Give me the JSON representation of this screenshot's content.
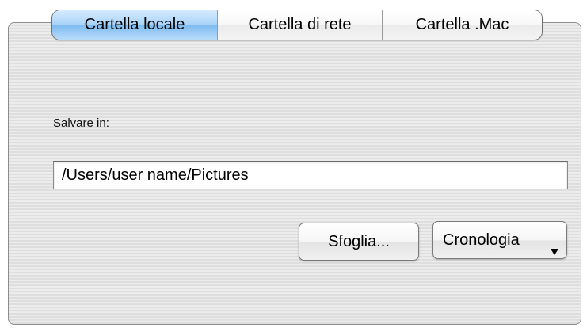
{
  "tabs": [
    {
      "label": "Cartella locale",
      "selected": true
    },
    {
      "label": "Cartella di rete",
      "selected": false
    },
    {
      "label": "Cartella .Mac",
      "selected": false
    }
  ],
  "save_location": {
    "label": "Salvare in:",
    "path_value": "/Users/user name/Pictures"
  },
  "buttons": {
    "browse_label": "Sfoglia...",
    "history_label": "Cronologia",
    "history_icon": "triangle-down-icon"
  },
  "colors": {
    "selected_tab": "#a9d3f8",
    "panel_background": "#e6e6e6"
  }
}
